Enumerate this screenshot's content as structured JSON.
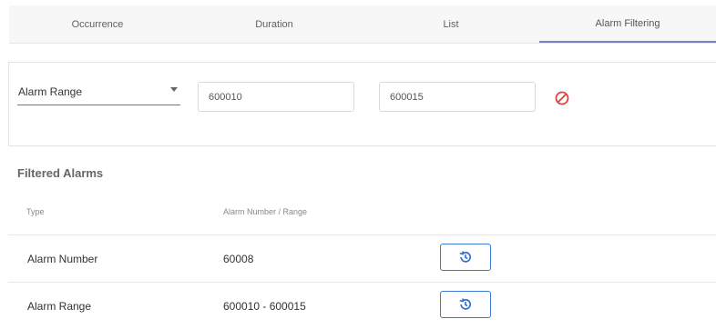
{
  "tabs": [
    {
      "label": "Occurrence",
      "active": false
    },
    {
      "label": "Duration",
      "active": false
    },
    {
      "label": "List",
      "active": false
    },
    {
      "label": "Alarm Filtering",
      "active": true
    }
  ],
  "filter": {
    "type_select": "Alarm Range",
    "from_value": "600010",
    "to_value": "600015",
    "clear_icon": "no-entry-icon"
  },
  "filtered": {
    "title": "Filtered Alarms",
    "columns": {
      "type": "Type",
      "range": "Alarm Number / Range"
    },
    "rows": [
      {
        "type": "Alarm Number",
        "range": "60008",
        "action_icon": "history-icon"
      },
      {
        "type": "Alarm Range",
        "range": "600010 - 600015",
        "action_icon": "history-icon"
      }
    ]
  },
  "colors": {
    "accent": "#7b7fc4",
    "button": "#3a7bd5",
    "danger": "#e0413a"
  }
}
